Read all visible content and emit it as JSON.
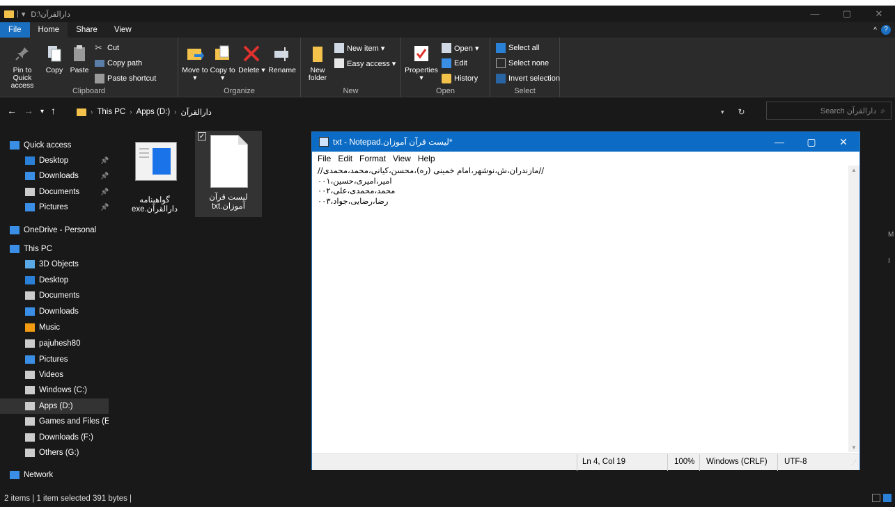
{
  "window": {
    "title": "D:\\دارالقرآن",
    "controls": [
      "—",
      "▢",
      "✕"
    ]
  },
  "tabs": [
    "File",
    "Home",
    "Share",
    "View"
  ],
  "ribbon": {
    "clipboard": {
      "label": "Clipboard",
      "pin": "Pin to Quick access",
      "copy": "Copy",
      "paste": "Paste",
      "cut": "Cut",
      "copy_path": "Copy path",
      "paste_shortcut": "Paste shortcut"
    },
    "organize": {
      "label": "Organize",
      "move_to": "Move to ▾",
      "copy_to": "Copy to ▾",
      "delete": "Delete ▾",
      "rename": "Rename"
    },
    "new": {
      "label": "New",
      "new_folder": "New folder",
      "new_item": "New item ▾",
      "easy_access": "Easy access ▾"
    },
    "open": {
      "label": "Open",
      "properties": "Properties ▾",
      "open": "Open ▾",
      "edit": "Edit",
      "history": "History"
    },
    "select": {
      "label": "Select",
      "select_all": "Select all",
      "select_none": "Select none",
      "invert": "Invert selection"
    }
  },
  "address": {
    "crumbs": [
      "This PC",
      "Apps (D:)",
      "دارالقرآن"
    ],
    "search_placeholder": "Search دارالقرآن"
  },
  "sidebar": {
    "items": [
      {
        "label": "Quick access",
        "icon": "star-icon",
        "color": "#3a8ee6"
      },
      {
        "label": "Desktop",
        "icon": "desktop-icon",
        "color": "#2a7fd6"
      },
      {
        "label": "Downloads",
        "icon": "download-icon",
        "color": "#3a8ee6"
      },
      {
        "label": "Documents",
        "icon": "document-icon",
        "color": "#ccc"
      },
      {
        "label": "Pictures",
        "icon": "pictures-icon",
        "color": "#3a8ee6"
      },
      {
        "label": "OneDrive - Personal",
        "icon": "cloud-icon",
        "color": "#3a8ee6"
      },
      {
        "label": "This PC",
        "icon": "pc-icon",
        "color": "#3a8ee6"
      },
      {
        "label": "3D Objects",
        "icon": "cube-icon",
        "color": "#5aa9e6"
      },
      {
        "label": "Desktop",
        "icon": "desktop-icon",
        "color": "#2a7fd6"
      },
      {
        "label": "Documents",
        "icon": "document-icon",
        "color": "#ccc"
      },
      {
        "label": "Downloads",
        "icon": "download-icon",
        "color": "#3a8ee6"
      },
      {
        "label": "Music",
        "icon": "music-icon",
        "color": "#f39c12"
      },
      {
        "label": "pajuhesh80",
        "icon": "user-folder-icon",
        "color": "#ccc"
      },
      {
        "label": "Pictures",
        "icon": "pictures-icon",
        "color": "#3a8ee6"
      },
      {
        "label": "Videos",
        "icon": "video-icon",
        "color": "#ccc"
      },
      {
        "label": "Windows (C:)",
        "icon": "drive-icon",
        "color": "#ccc"
      },
      {
        "label": "Apps (D:)",
        "icon": "drive-icon",
        "color": "#ccc"
      },
      {
        "label": "Games and Files (E:)",
        "icon": "drive-icon",
        "color": "#ccc"
      },
      {
        "label": "Downloads (F:)",
        "icon": "drive-icon",
        "color": "#ccc"
      },
      {
        "label": "Others (G:)",
        "icon": "drive-icon",
        "color": "#ccc"
      },
      {
        "label": "Network",
        "icon": "network-icon",
        "color": "#3a8ee6"
      }
    ]
  },
  "files": [
    {
      "name": "گواهینامه دارالقرآن.exe",
      "line1": "گواهینامه",
      "line2": "دارالقرآن.exe",
      "icon": "exe-icon"
    },
    {
      "name": "لیست قرآن آموزان.txt",
      "line1": "لیست قرآن",
      "line2": "آموزان.txt",
      "icon": "text-file-icon"
    }
  ],
  "status": {
    "text": "2 items  |  1 item selected  391 bytes  |"
  },
  "notepad": {
    "title": "*لیست قرآن آموزان.txt - Notepad",
    "menu": [
      "File",
      "Edit",
      "Format",
      "View",
      "Help"
    ],
    "lines": [
      "//مازندران،ش،نوشهر،امام خمینی (ره)،محسن،کیانی،محمد،محمدی//",
      "امیر،امیری،حسین،۰۰۱",
      "محمد،محمدی،علی،۰۰۲",
      "رضا،رضایی،جواد،۰۰۳"
    ],
    "status": {
      "position": "Ln 4, Col 19",
      "zoom": "100%",
      "eol": "Windows (CRLF)",
      "encoding": "UTF-8"
    }
  },
  "colors": {
    "accent": "#0c6cc5",
    "file_tab": "#1a6fc1",
    "folder": "#f3c24a"
  }
}
